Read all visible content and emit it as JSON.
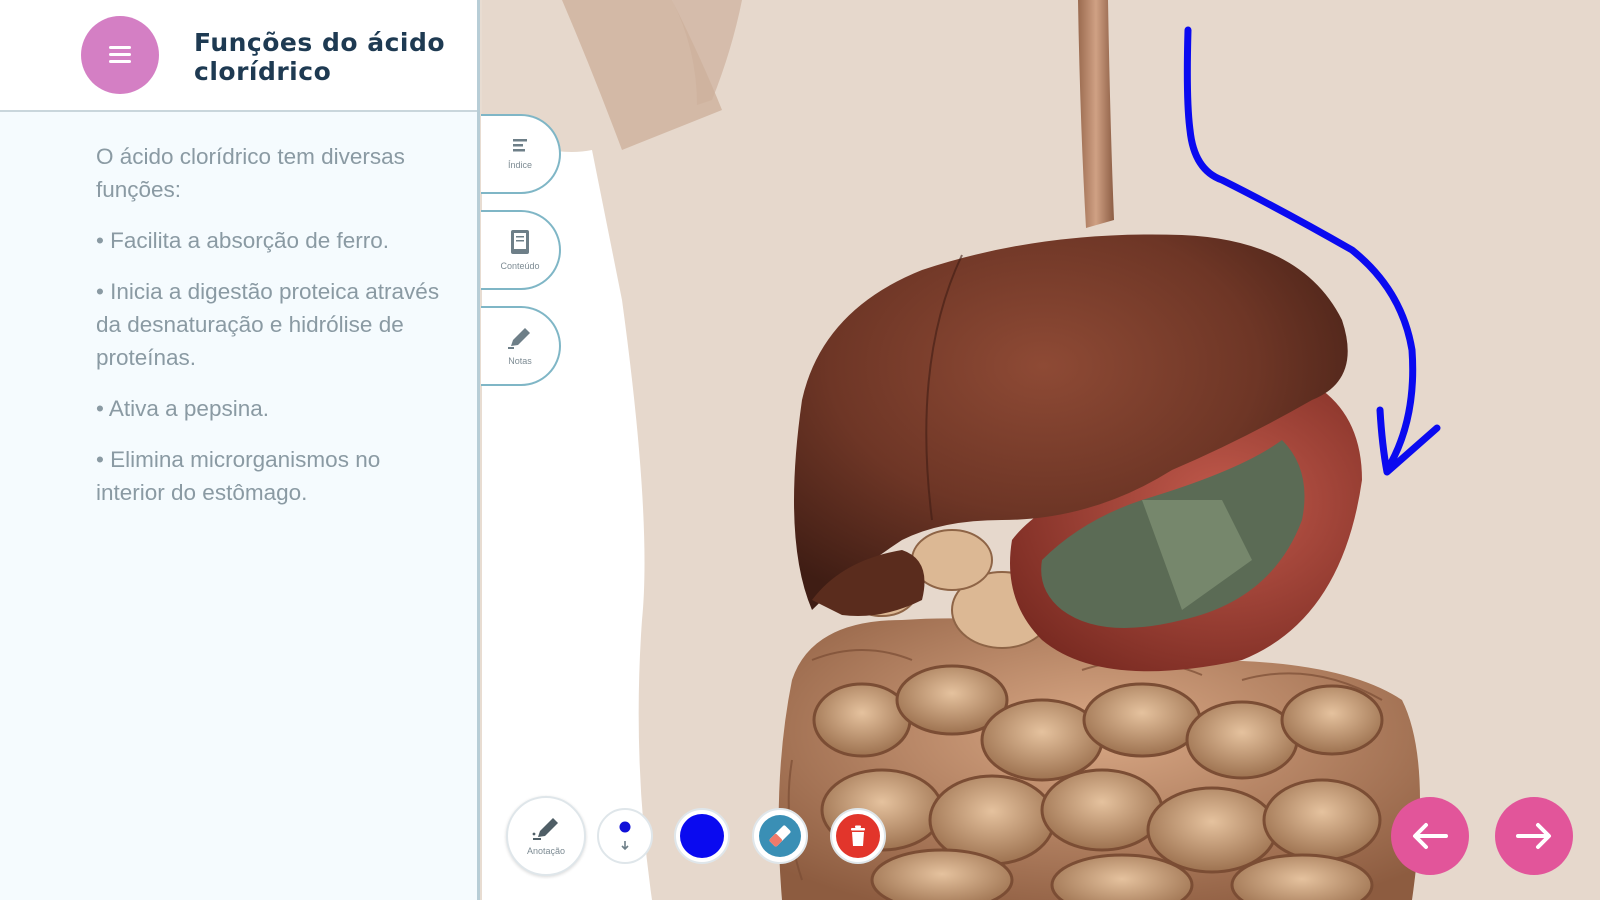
{
  "header": {
    "menu_icon": "menu-icon",
    "title": "Funções do ácido clorídrico"
  },
  "content": {
    "paragraphs": [
      "O ácido clorídrico tem diversas funções:",
      "• Facilita a absorção de ferro.",
      "• Inicia a digestão proteica através da desnaturação e hidrólise de proteínas.",
      "• Ativa a pepsina.",
      "• Elimina microrganismos no interior do estômago."
    ]
  },
  "side_tabs": [
    {
      "label": "Índice",
      "icon": "index-list-icon"
    },
    {
      "label": "Conteúdo",
      "icon": "book-icon"
    },
    {
      "label": "Notas",
      "icon": "pencil-icon"
    }
  ],
  "toolbar": {
    "annotation_label": "Anotação",
    "annotation_icon": "pencil-icon",
    "size_icon": "brush-size-icon",
    "current_color": "#0a0af0",
    "eraser_icon": "eraser-icon",
    "delete_icon": "trash-icon"
  },
  "navigation": {
    "prev_icon": "arrow-left-icon",
    "next_icon": "arrow-right-icon"
  },
  "colors": {
    "menu_button": "#d47fc4",
    "nav_buttons": "#e2559a",
    "annotation_stroke": "#0a0af0",
    "delete_button": "#e2352b"
  }
}
